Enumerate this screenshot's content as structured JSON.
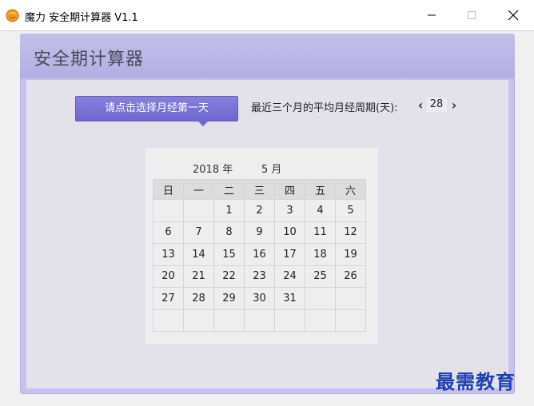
{
  "window": {
    "title": "魔力 安全期计算器 V1.1",
    "icon": "orange-app-icon",
    "controls": [
      "minimize-icon",
      "maximize-icon",
      "close-icon"
    ]
  },
  "app": {
    "heading": "安全期计算器",
    "accent_color": "#7067cf",
    "select_button_label": "请点击选择月经第一天",
    "cycle": {
      "label": "最近三个月的平均月经周期(天):",
      "value": "28",
      "prev_label": "‹",
      "next_label": "›"
    }
  },
  "calendar": {
    "year_label": "2018 年",
    "month_label": "5 月",
    "weekdays": [
      "日",
      "一",
      "二",
      "三",
      "四",
      "五",
      "六"
    ],
    "weeks": [
      [
        "",
        "",
        "1",
        "2",
        "3",
        "4",
        "5"
      ],
      [
        "6",
        "7",
        "8",
        "9",
        "10",
        "11",
        "12"
      ],
      [
        "13",
        "14",
        "15",
        "16",
        "17",
        "18",
        "19"
      ],
      [
        "20",
        "21",
        "22",
        "23",
        "24",
        "25",
        "26"
      ],
      [
        "27",
        "28",
        "29",
        "30",
        "31",
        "",
        ""
      ],
      [
        "",
        "",
        "",
        "",
        "",
        "",
        ""
      ]
    ]
  },
  "watermark": "最需教育"
}
